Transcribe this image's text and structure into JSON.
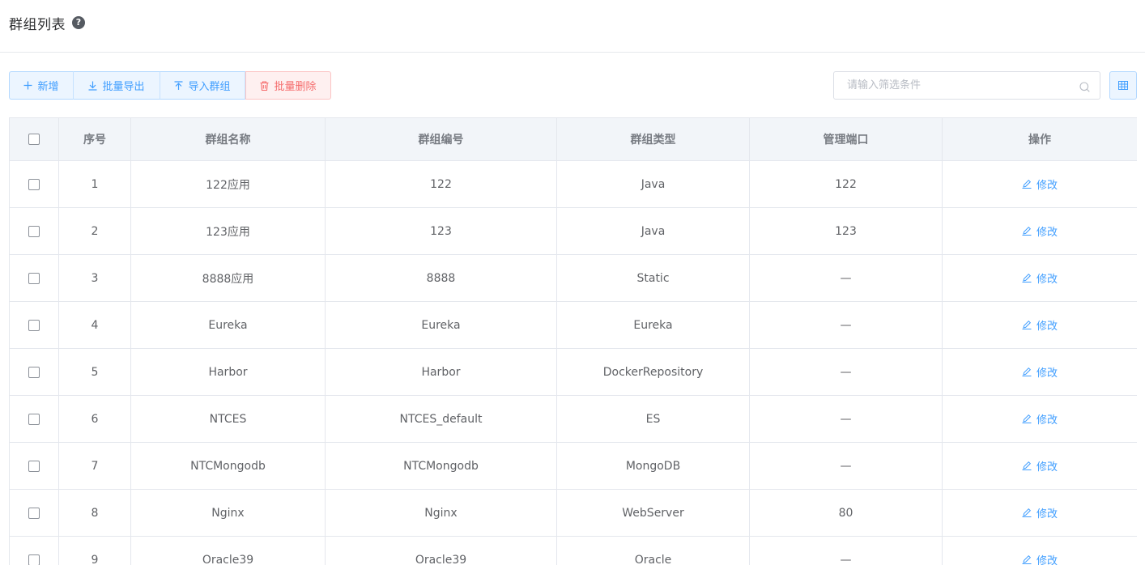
{
  "header": {
    "title": "群组列表",
    "help_icon": "?"
  },
  "toolbar": {
    "add_label": "新增",
    "export_label": "批量导出",
    "import_label": "导入群组",
    "delete_label": "批量删除",
    "search_placeholder": "请输入筛选条件"
  },
  "colors": {
    "accent": "#409eff",
    "danger": "#f56c6c",
    "header_bg": "#f2f5f9"
  },
  "table": {
    "columns": [
      "序号",
      "群组名称",
      "群组编号",
      "群组类型",
      "管理端口",
      "操作"
    ],
    "edit_label": "修改",
    "rows": [
      {
        "index": "1",
        "name": "122应用",
        "code": "122",
        "type": "Java",
        "port": "122"
      },
      {
        "index": "2",
        "name": "123应用",
        "code": "123",
        "type": "Java",
        "port": "123"
      },
      {
        "index": "3",
        "name": "8888应用",
        "code": "8888",
        "type": "Static",
        "port": "—"
      },
      {
        "index": "4",
        "name": "Eureka",
        "code": "Eureka",
        "type": "Eureka",
        "port": "—"
      },
      {
        "index": "5",
        "name": "Harbor",
        "code": "Harbor",
        "type": "DockerRepository",
        "port": "—"
      },
      {
        "index": "6",
        "name": "NTCES",
        "code": "NTCES_default",
        "type": "ES",
        "port": "—"
      },
      {
        "index": "7",
        "name": "NTCMongodb",
        "code": "NTCMongodb",
        "type": "MongoDB",
        "port": "—"
      },
      {
        "index": "8",
        "name": "Nginx",
        "code": "Nginx",
        "type": "WebServer",
        "port": "80"
      },
      {
        "index": "9",
        "name": "Oracle39",
        "code": "Oracle39",
        "type": "Oracle",
        "port": "—"
      }
    ]
  }
}
